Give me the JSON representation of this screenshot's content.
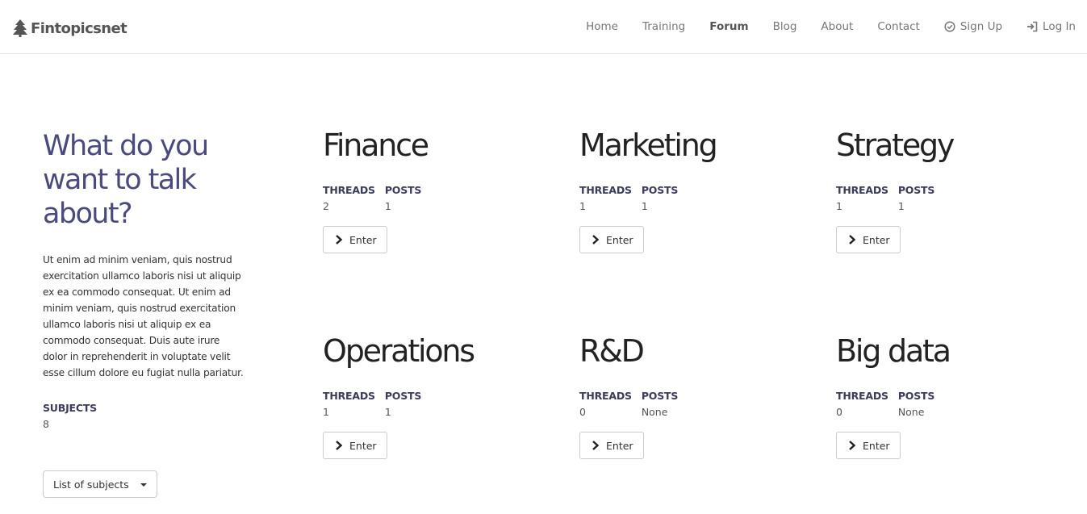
{
  "brand": {
    "name": "Fintopicsnet",
    "icon": "tree-icon"
  },
  "nav": [
    {
      "label": "Home",
      "active": false
    },
    {
      "label": "Training",
      "active": false
    },
    {
      "label": "Forum",
      "active": true
    },
    {
      "label": "Blog",
      "active": false
    },
    {
      "label": "About",
      "active": false
    },
    {
      "label": "Contact",
      "active": false
    },
    {
      "label": "Sign Up",
      "icon": "check-circle-icon"
    },
    {
      "label": "Log In",
      "icon": "login-icon"
    }
  ],
  "intro": {
    "title": "What do you want to talk about?",
    "text": "Ut enim ad minim veniam, quis nostrud exercitation ullamco laboris nisi ut aliquip ex ea commodo consequat. Ut enim ad minim veniam, quis nostrud exercitation ullamco laboris nisi ut aliquip ex ea commodo consequat. Duis aute irure dolor in reprehenderit in voluptate velit esse cillum dolore eu fugiat nulla pariatur.",
    "subjects_label": "SUBJECTS",
    "subjects_count": "8",
    "dropdown_label": "List of subjects"
  },
  "stats_labels": {
    "threads": "THREADS",
    "posts": "POSTS"
  },
  "enter_label": "Enter",
  "subjects": [
    {
      "name": "Finance",
      "threads": "2",
      "posts": "1"
    },
    {
      "name": "Marketing",
      "threads": "1",
      "posts": "1"
    },
    {
      "name": "Strategy",
      "threads": "1",
      "posts": "1"
    },
    {
      "name": "Operations",
      "threads": "1",
      "posts": "1"
    },
    {
      "name": "R&D",
      "threads": "0",
      "posts": "None"
    },
    {
      "name": "Big data",
      "threads": "0",
      "posts": "None"
    }
  ],
  "colors": {
    "heading_accent": "#4a4a7e",
    "label": "#3b3b5c",
    "nav_text": "#777777"
  }
}
